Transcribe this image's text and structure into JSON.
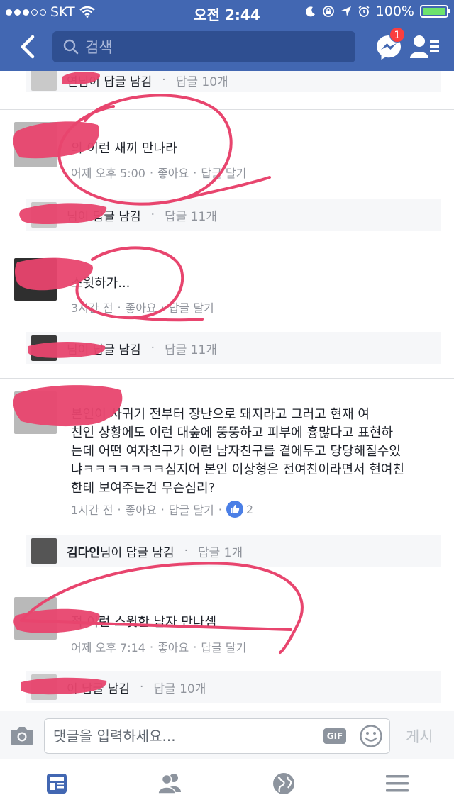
{
  "status_bar": {
    "carrier": "SKT",
    "time": "오전 2:44",
    "battery": "100%",
    "battery_level": 1.0,
    "signal_bars": 3
  },
  "nav": {
    "search_placeholder": "검색",
    "messenger_badge": "1"
  },
  "threads": [
    {
      "reply_summary": {
        "name_partial": "연님이 답글 남김",
        "count": "답글 10개"
      }
    },
    {
      "text": "의 이런 새끼 만나라",
      "time": "어제 오후 5:00",
      "like": "좋아요",
      "reply": "답글 달기",
      "reply_summary": {
        "name_partial": "님이 답글 남김",
        "count": "답글 11개"
      }
    },
    {
      "text": "스윗하가...",
      "time": "3시간 전",
      "like": "좋아요",
      "reply": "답글 달기",
      "reply_summary": {
        "name_partial": "님이 답글 남김",
        "count": "답글 11개"
      }
    },
    {
      "text": "본인이 사귀기 전부터 장난으로 돼지라고 그러고 현재 여친인 상황에도 이런 대숲에 뚱뚱하고 피부에 흉많다고 표현하는데 어떤 여자친구가 이런 남자친구를 곁에두고 당당해질수있냐ㅋㅋㅋㅋㅋㅋㅋ심지어 본인 이상형은 전여친이라면서 현여친한테 보여주는건 무슨심리?",
      "lines": [
        "본인이 사귀기 전부터 장난으로 돼지라고 그러고 현재 여",
        "친인 상황에도 이런 대숲에 뚱뚱하고 피부에 흉많다고 표현하",
        "는데 어떤 여자친구가 이런 남자친구를 곁에두고 당당해질수있",
        "냐ㅋㅋㅋㅋㅋㅋㅋ심지어 본인 이상형은 전여친이라면서 현여친",
        "한테 보여주는건 무슨심리?"
      ],
      "time": "1시간 전",
      "like": "좋아요",
      "reply": "답글 달기",
      "like_count": "2",
      "reply_summary": {
        "name": "김다인",
        "name_suffix": "님이 답글 남김",
        "count": "답글 1개"
      }
    },
    {
      "text": "적 이런 스윗한 남자 만나셈",
      "time": "어제 오후 7:14",
      "like": "좋아요",
      "reply": "답글 달기",
      "reply_summary": {
        "name_partial": "이 답글 남김",
        "count": "답글 10개"
      }
    }
  ],
  "composer": {
    "placeholder": "댓글을 입력하세요...",
    "gif_label": "GIF",
    "post_label": "게시"
  },
  "separator": "·",
  "colors": {
    "brand": "#4267b2",
    "marker": "#e8456e",
    "muted": "#90949c"
  }
}
